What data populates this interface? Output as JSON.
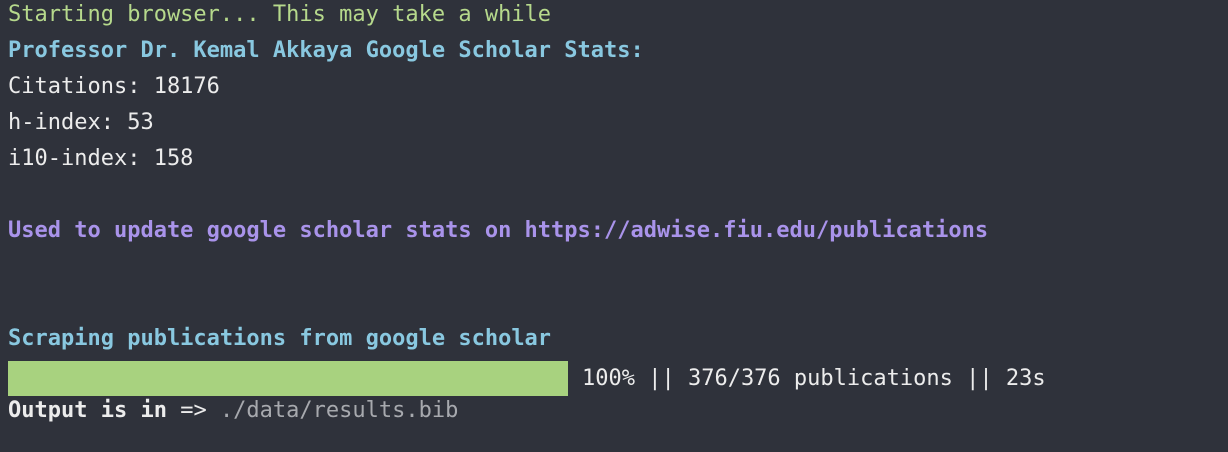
{
  "colors": {
    "background": "#2f323b",
    "green_text": "#b6d98c",
    "cyan_text": "#89c8e0",
    "purple_text": "#a993ea",
    "progress_fill": "#a8d27f"
  },
  "lines": {
    "starting": "Starting browser... This may take a while",
    "title": "Professor Dr. Kemal Akkaya Google Scholar Stats:",
    "citations": "Citations: 18176",
    "h_index": "h-index: 53",
    "i10_index": "i10-index: 158",
    "update_note": "Used to update google scholar stats on https://adwise.fiu.edu/publications",
    "scraping": "Scraping publications from google scholar"
  },
  "progress": {
    "fraction": 1.0,
    "text": "100% || 376/376 publications || 23s"
  },
  "output": {
    "label": "Output is in",
    "arrow": " => ",
    "path": "./data/results.bib"
  }
}
